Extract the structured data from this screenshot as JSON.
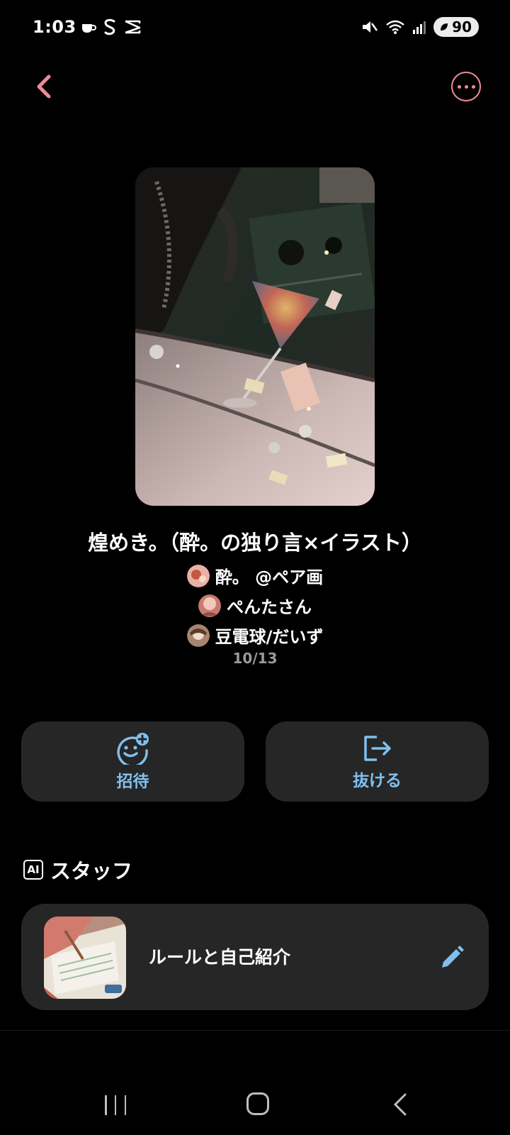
{
  "status_bar": {
    "time": "1:03",
    "battery": "90",
    "icons": [
      "coffee-icon",
      "s-app-icon",
      "capcut-icon",
      "mute-icon",
      "wifi-icon",
      "signal-icon"
    ]
  },
  "nav": {
    "back_icon": "chevron-left-icon",
    "more_icon": "more-horizontal-icon",
    "accent_color": "#f08a96"
  },
  "group": {
    "title": "煌めき。（酔。の独り言×イラスト）",
    "members": [
      {
        "name": "酔。 @ペア画"
      },
      {
        "name": "ぺんたさん"
      },
      {
        "name": "豆電球/だいず"
      }
    ],
    "member_count": "10/13"
  },
  "actions": {
    "invite_label": "招待",
    "leave_label": "抜ける",
    "label_color": "#7fc0ef"
  },
  "staff": {
    "header": "スタッフ",
    "badge": "AI",
    "item_label": "ルールと自己紹介"
  },
  "system_nav": {
    "icons": [
      "recents-icon",
      "home-icon",
      "back-icon"
    ]
  }
}
